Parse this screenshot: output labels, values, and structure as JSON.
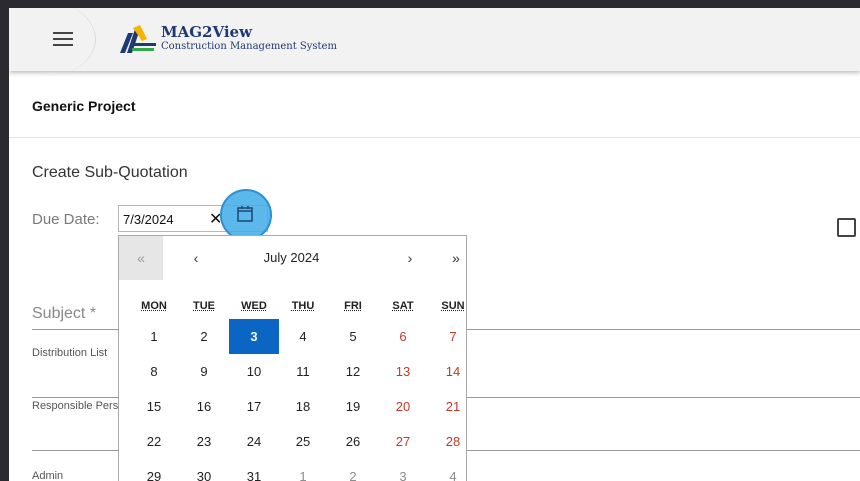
{
  "brand": {
    "title": "MAG2View",
    "subtitle": "Construction Management System"
  },
  "project": {
    "name": "Generic Project"
  },
  "form": {
    "section_title": "Create Sub-Quotation",
    "due_label": "Due Date:",
    "due_value": "7/3/2024",
    "clear_glyph": "✕",
    "subject_label": "Subject *",
    "distribution_label": "Distribution List",
    "responsible_label": "Responsible Person",
    "admin_label": "Admin"
  },
  "calendar": {
    "nav": {
      "prev_year": "«",
      "prev_month": "‹",
      "next_month": "›",
      "next_year": "»"
    },
    "month_label": "July 2024",
    "weekdays": [
      "MON",
      "TUE",
      "WED",
      "THU",
      "FRI",
      "SAT",
      "SUN"
    ],
    "weeks": [
      [
        "1",
        "2",
        "3",
        "4",
        "5",
        "6",
        "7"
      ],
      [
        "8",
        "9",
        "10",
        "11",
        "12",
        "13",
        "14"
      ],
      [
        "15",
        "16",
        "17",
        "18",
        "19",
        "20",
        "21"
      ],
      [
        "22",
        "23",
        "24",
        "25",
        "26",
        "27",
        "28"
      ],
      [
        "29",
        "30",
        "31",
        "1",
        "2",
        "3",
        "4"
      ]
    ],
    "selected_day": "3",
    "colors": {
      "selected": "#0a66c2",
      "weekend": "#c0392b",
      "other_month": "#8c8c8c"
    }
  },
  "icons": [
    "menu-icon",
    "calendar-icon",
    "close-icon"
  ]
}
